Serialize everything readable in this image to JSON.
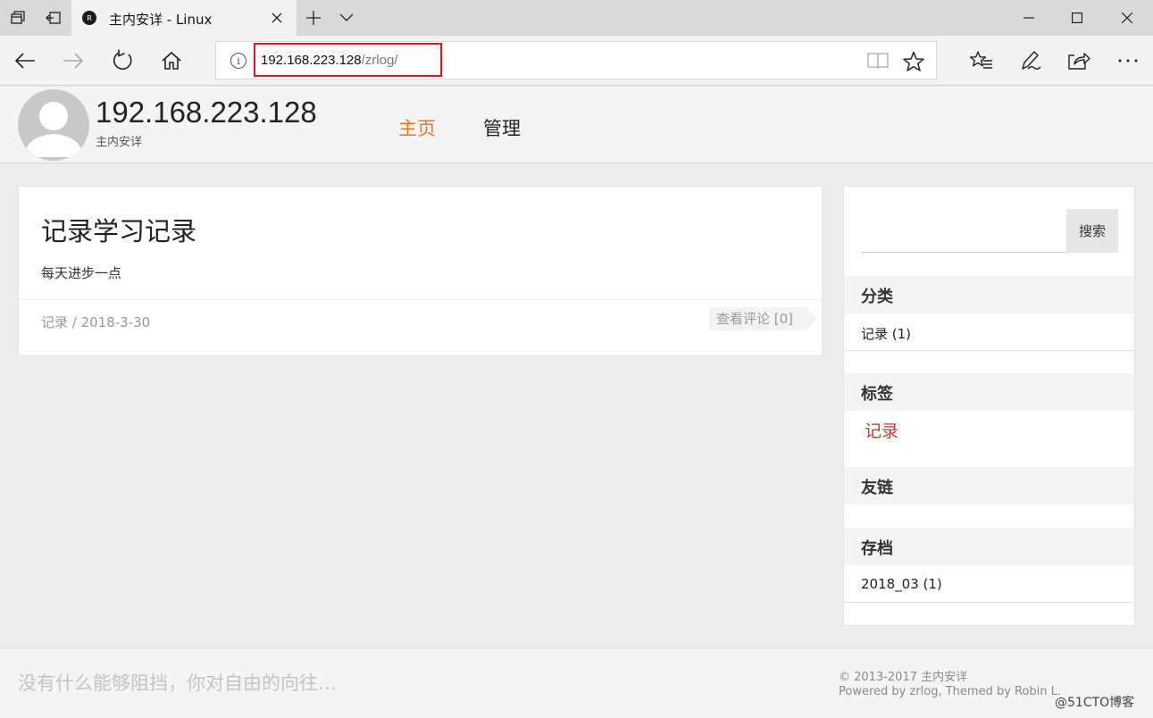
{
  "browser": {
    "tab_title": "主内安详 - Linux",
    "tab_favicon_letter": "R",
    "url_host": "192.168.223.128",
    "url_path": "/zrlog/",
    "info_glyph": "i",
    "icons": [
      "set-aside-tabs-icon",
      "tab-preview-icon",
      "close-tab-icon",
      "new-tab-icon",
      "tab-list-icon",
      "minimize-icon",
      "maximize-icon",
      "close-window-icon",
      "back-icon",
      "forward-icon",
      "refresh-icon",
      "home-icon",
      "info-icon",
      "reading-view-icon",
      "favorite-star-icon",
      "favorites-icon",
      "notes-icon",
      "share-icon",
      "more-icon"
    ]
  },
  "site": {
    "title": "192.168.223.128",
    "subtitle": "主内安详",
    "menu": [
      {
        "label": "主页",
        "active": true,
        "color": "#f0761a"
      },
      {
        "label": "管理",
        "active": false
      }
    ]
  },
  "article": {
    "title": "记录学习记录",
    "summary": "每天进步一点",
    "meta": "记录 / 2018-3-30",
    "comments_label": "查看评论 [0]"
  },
  "sidebar": {
    "search_button": "搜索",
    "search_value": "",
    "categories_title": "分类",
    "categories": [
      "记录 (1)"
    ],
    "tags_title": "标签",
    "tags": [
      "记录"
    ],
    "links_title": "友链",
    "archive_title": "存档",
    "archives": [
      "2018_03 (1)"
    ]
  },
  "footer": {
    "slogan": "没有什么能够阻挡，你对自由的向往…",
    "copyright": "© 2013-2017 主内安详",
    "powered": "Powered by zrlog, Themed by Robin L.",
    "watermark": "@51CTO博客"
  },
  "colors": {
    "accent": "#f0761a",
    "tag": "#c0392b",
    "url_highlight": "#e0191c"
  }
}
